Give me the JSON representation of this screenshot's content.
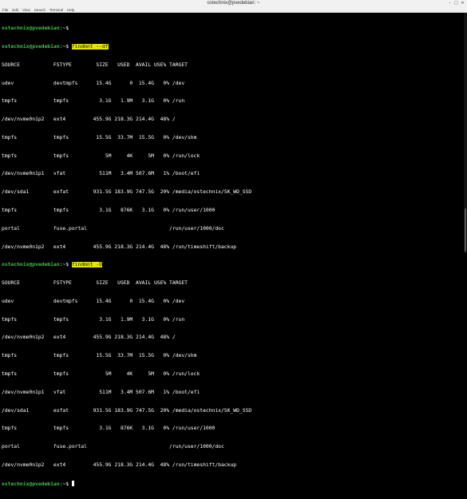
{
  "window": {
    "title": "ostechnix@pvedebian: ~",
    "menu": [
      "File",
      "Edit",
      "View",
      "Search",
      "Terminal",
      "Help"
    ]
  },
  "colors": {
    "prompt": "#3fc24b",
    "highlight": "#e5e600",
    "background": "#000000"
  },
  "prompt": {
    "user_host": "ostechnix@pvedebian",
    "path_sep": ":~$ "
  },
  "commands": [
    "findmnt --df",
    "findmnt -D"
  ],
  "header": "SOURCE           FSTYPE        SIZE   USED  AVAIL USE% TARGET",
  "outputs": [
    [
      "udev             devtmpfs      15.4G      0  15.4G   0% /dev",
      "tmpfs            tmpfs          3.1G   1.9M   3.1G   0% /run",
      "/dev/nvme0n1p2   ext4         455.9G 218.3G 214.4G  48% /",
      "tmpfs            tmpfs         15.5G  33.7M  15.5G   0% /dev/shm",
      "tmpfs            tmpfs            5M     4K     5M   0% /run/lock",
      "/dev/nvme0n1p1   vfat           511M   3.4M 507.6M   1% /boot/efi",
      "/dev/sda1        exfat        931.5G 183.9G 747.5G  20% /media/ostechnix/SK_WD_SSD",
      "tmpfs            tmpfs          3.1G   876K   3.1G   0% /run/user/1000",
      "portal           fuse.portal                           /run/user/1000/doc",
      "/dev/nvme0n1p2   ext4         455.9G 218.3G 214.4G  48% /run/timeshift/backup"
    ],
    [
      "udev             devtmpfs      15.4G      0  15.4G   0% /dev",
      "tmpfs            tmpfs          3.1G   1.9M   3.1G   0% /run",
      "/dev/nvme0n1p2   ext4         455.9G 218.3G 214.4G  48% /",
      "tmpfs            tmpfs         15.5G  33.7M  15.5G   0% /dev/shm",
      "tmpfs            tmpfs            5M     4K     5M   0% /run/lock",
      "/dev/nvme0n1p1   vfat           511M   3.4M 507.6M   1% /boot/efi",
      "/dev/sda1        exfat        931.5G 183.9G 747.5G  20% /media/ostechnix/SK_WD_SSD",
      "tmpfs            tmpfs          3.1G   876K   3.1G   0% /run/user/1000",
      "portal           fuse.portal                           /run/user/1000/doc",
      "/dev/nvme0n1p2   ext4         455.9G 218.3G 214.4G  48% /run/timeshift/backup"
    ]
  ]
}
